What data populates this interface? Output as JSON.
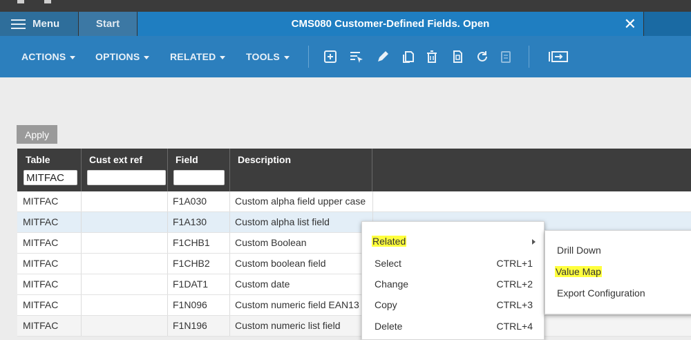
{
  "tabs": {
    "menu_label": "Menu",
    "start_label": "Start",
    "active_title": "CMS080 Customer-Defined Fields. Open",
    "close_glyph": "✕"
  },
  "toolbar": {
    "menus": [
      "ACTIONS",
      "OPTIONS",
      "RELATED",
      "TOOLS"
    ],
    "icons": [
      "add-icon",
      "select-list-icon",
      "edit-pencil-icon",
      "copy-icon",
      "delete-trash-icon",
      "display-icon",
      "refresh-icon",
      "clipboard-disabled-icon",
      "export-screen-icon"
    ]
  },
  "apply_label": "Apply",
  "grid": {
    "headers": [
      "Table",
      "Cust ext ref",
      "Field",
      "Description"
    ],
    "filters": [
      "MITFAC",
      "",
      "",
      ""
    ],
    "rows": [
      [
        "MITFAC",
        "",
        "F1A030",
        "Custom alpha field upper case"
      ],
      [
        "MITFAC",
        "",
        "F1A130",
        "Custom alpha list field"
      ],
      [
        "MITFAC",
        "",
        "F1CHB1",
        "Custom Boolean"
      ],
      [
        "MITFAC",
        "",
        "F1CHB2",
        "Custom boolean field"
      ],
      [
        "MITFAC",
        "",
        "F1DAT1",
        "Custom date"
      ],
      [
        "MITFAC",
        "",
        "F1N096",
        "Custom numeric field EAN13"
      ],
      [
        "MITFAC",
        "",
        "F1N196",
        "Custom numeric list field"
      ]
    ]
  },
  "context_menu": {
    "items": [
      {
        "label": "Related",
        "shortcut": ""
      },
      {
        "label": "Select",
        "shortcut": "CTRL+1"
      },
      {
        "label": "Change",
        "shortcut": "CTRL+2"
      },
      {
        "label": "Copy",
        "shortcut": "CTRL+3"
      },
      {
        "label": "Delete",
        "shortcut": "CTRL+4"
      }
    ]
  },
  "submenu": {
    "items": [
      "Drill Down",
      "Value Map",
      "Export Configuration"
    ]
  },
  "colors": {
    "tab_active": "#1f7ec1",
    "toolbar": "#2c7fbd",
    "grid_header": "#3d3d3d",
    "highlight": "#ffff3d"
  }
}
